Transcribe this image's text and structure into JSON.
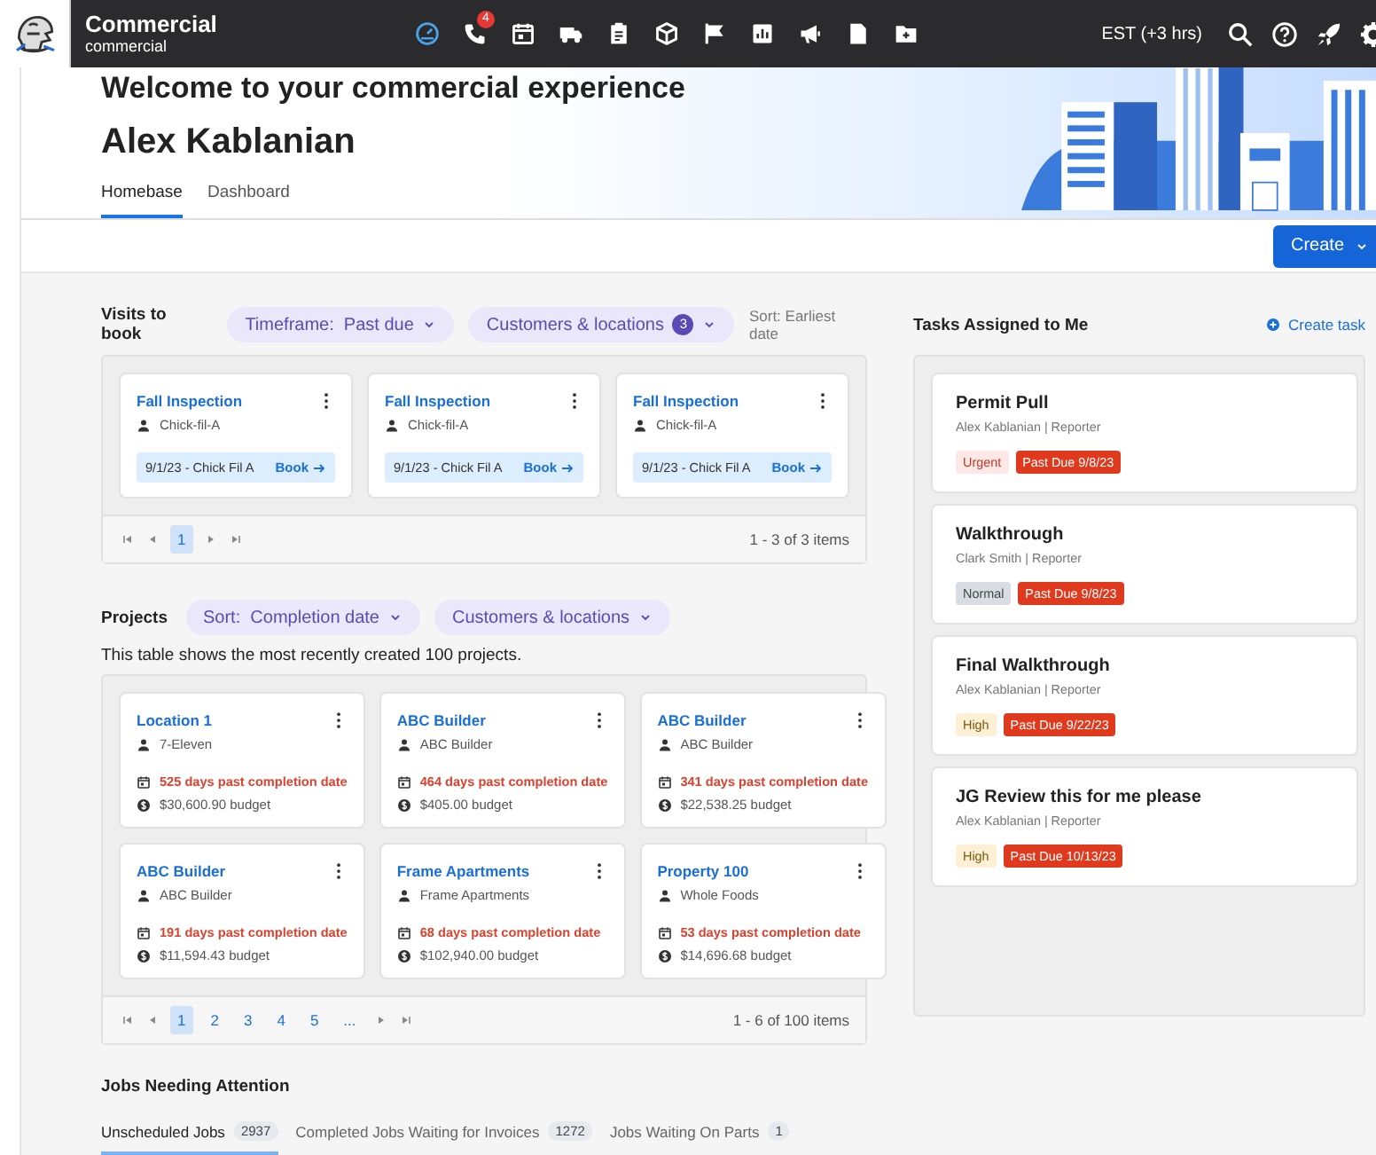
{
  "top_bar": {
    "app_title": "Commercial",
    "app_subtitle": "commercial",
    "nav_icons": [
      {
        "kind": "gauge",
        "selected": true
      },
      {
        "kind": "phone",
        "selected": false,
        "badge": "4"
      },
      {
        "kind": "calendar",
        "selected": false
      },
      {
        "kind": "truck",
        "selected": false
      },
      {
        "kind": "clipboard",
        "selected": false
      },
      {
        "kind": "box",
        "selected": false
      },
      {
        "kind": "flag",
        "selected": false
      },
      {
        "kind": "chart",
        "selected": false
      },
      {
        "kind": "megaphone",
        "selected": false
      },
      {
        "kind": "file",
        "selected": false
      },
      {
        "kind": "folder",
        "selected": false
      }
    ],
    "timezone": "EST (+3 hrs)",
    "tools": [
      {
        "kind": "search"
      },
      {
        "kind": "help"
      },
      {
        "kind": "rocket"
      },
      {
        "kind": "gear"
      }
    ]
  },
  "hero": {
    "greeting": "Welcome to your commercial experience",
    "user_name": "Alex Kablanian",
    "tabs": [
      {
        "label": "Homebase",
        "selected": true
      },
      {
        "label": "Dashboard",
        "selected": false
      }
    ]
  },
  "create_button": "Create",
  "visits": {
    "title": "Visits to book",
    "filters": [
      {
        "label": "Timeframe:  Past due"
      },
      {
        "label": "Customers & locations",
        "count": "3"
      }
    ],
    "sort": "Sort: Earliest date",
    "cards": [
      {
        "title": "Fall Inspection",
        "customer": "Chick-fil-A",
        "visit": "9/1/23 - Chick Fil A",
        "action": "Book"
      },
      {
        "title": "Fall Inspection",
        "customer": "Chick-fil-A",
        "visit": "9/1/23 - Chick Fil A",
        "action": "Book"
      },
      {
        "title": "Fall Inspection",
        "customer": "Chick-fil-A",
        "visit": "9/1/23 - Chick Fil A",
        "action": "Book"
      }
    ],
    "pagination": {
      "pages": [
        {
          "label": "1",
          "selected": true
        }
      ],
      "summary": "1 - 3 of 3 items"
    }
  },
  "projects": {
    "title": "Projects",
    "filters": [
      {
        "label": "Sort:  Completion date"
      },
      {
        "label": "Customers & locations"
      }
    ],
    "description": "This table shows the most recently created 100 projects.",
    "cards": [
      {
        "title": "Location 1",
        "customer": "7-Eleven",
        "overdue": "525 days past completion date",
        "budget": "$30,600.90 budget"
      },
      {
        "title": "ABC Builder",
        "customer": "ABC Builder",
        "overdue": "464 days past completion date",
        "budget": "$405.00 budget"
      },
      {
        "title": "ABC Builder",
        "customer": "ABC Builder",
        "overdue": "341 days past completion date",
        "budget": "$22,538.25 budget"
      },
      {
        "title": "ABC Builder",
        "customer": "ABC Builder",
        "overdue": "191 days past completion date",
        "budget": "$11,594.43 budget"
      },
      {
        "title": "Frame Apartments",
        "customer": "Frame Apartments",
        "overdue": "68 days past completion date",
        "budget": "$102,940.00 budget"
      },
      {
        "title": "Property 100",
        "customer": "Whole Foods",
        "overdue": "53 days past completion date",
        "budget": "$14,696.68 budget"
      }
    ],
    "pagination": {
      "pages": [
        {
          "label": "1",
          "selected": true
        },
        {
          "label": "2",
          "selected": false
        },
        {
          "label": "3",
          "selected": false
        },
        {
          "label": "4",
          "selected": false
        },
        {
          "label": "5",
          "selected": false
        },
        {
          "label": "...",
          "selected": false
        }
      ],
      "summary": "1 - 6 of 100 items"
    }
  },
  "tasks": {
    "title": "Tasks Assigned to Me",
    "create_link": "Create task",
    "items": [
      {
        "title": "Permit Pull",
        "assignee": "Alex Kablanian | Reporter",
        "priority": {
          "label": "Urgent",
          "kind": "urgent"
        },
        "due": "Past Due 9/8/23"
      },
      {
        "title": "Walkthrough",
        "assignee": "Clark Smith | Reporter",
        "priority": {
          "label": "Normal",
          "kind": "normal"
        },
        "due": "Past Due 9/8/23"
      },
      {
        "title": "Final Walkthrough",
        "assignee": "Alex Kablanian | Reporter",
        "priority": {
          "label": "High",
          "kind": "high"
        },
        "due": "Past Due 9/22/23"
      },
      {
        "title": "JG Review this for me please",
        "assignee": "Alex Kablanian | Reporter",
        "priority": {
          "label": "High",
          "kind": "high"
        },
        "due": "Past Due 10/13/23"
      }
    ]
  },
  "jobs": {
    "title": "Jobs Needing Attention",
    "tabs": [
      {
        "label": "Unscheduled Jobs",
        "count": "2937",
        "selected": true
      },
      {
        "label": "Completed Jobs Waiting for Invoices",
        "count": "1272",
        "selected": false
      },
      {
        "label": "Jobs Waiting On Parts",
        "count": "1",
        "selected": false
      }
    ]
  }
}
